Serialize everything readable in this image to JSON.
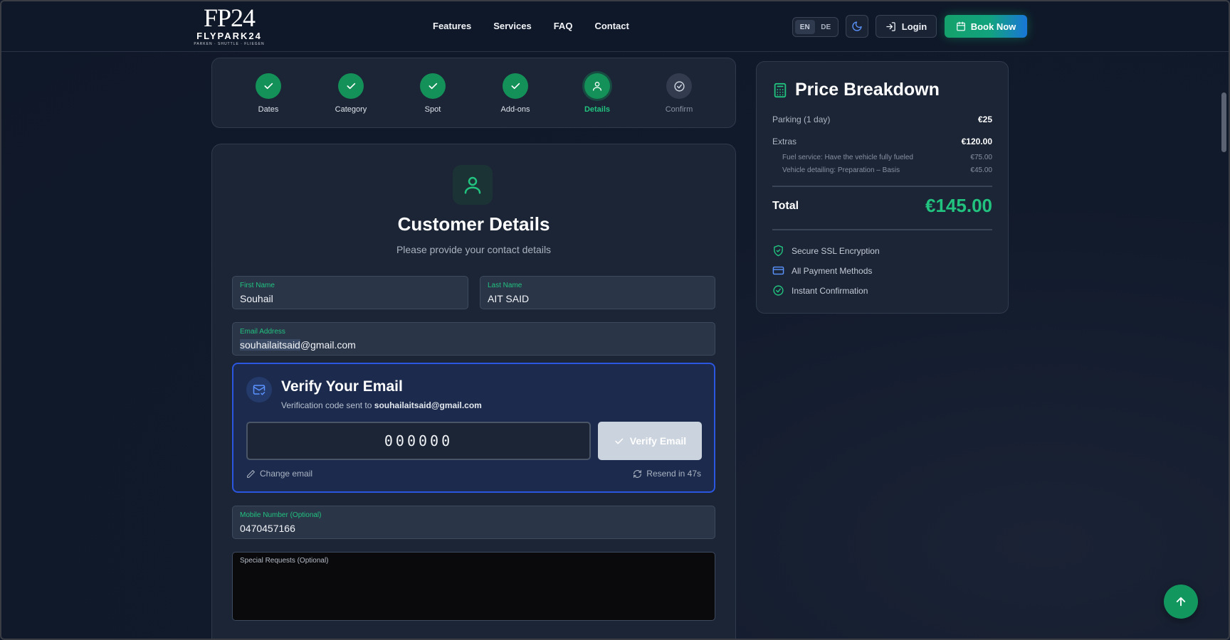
{
  "header": {
    "logo": {
      "mark": "FP24",
      "word": "FLYPARK24",
      "tagline": "PARKEN · SHUTTLE · FLIEGEN"
    },
    "nav": [
      "Features",
      "Services",
      "FAQ",
      "Contact"
    ],
    "lang": {
      "en": "EN",
      "de": "DE",
      "selected": "EN"
    },
    "login_label": "Login",
    "book_label": "Book Now"
  },
  "stepper": {
    "steps": [
      {
        "label": "Dates",
        "state": "done"
      },
      {
        "label": "Category",
        "state": "done"
      },
      {
        "label": "Spot",
        "state": "done"
      },
      {
        "label": "Add-ons",
        "state": "done"
      },
      {
        "label": "Details",
        "state": "current"
      },
      {
        "label": "Confirm",
        "state": "pending"
      }
    ]
  },
  "form": {
    "title": "Customer Details",
    "subtitle": "Please provide your contact details",
    "first_name": {
      "label": "First Name",
      "value": "Souhail"
    },
    "last_name": {
      "label": "Last Name",
      "value": "AIT SAID"
    },
    "email": {
      "label": "Email Address",
      "value_highlight": "souhailaitsaid",
      "value_rest": "@gmail.com"
    },
    "verify": {
      "title": "Verify Your Email",
      "sent_prefix": "Verification code sent to",
      "sent_to": "souhailaitsaid@gmail.com",
      "code_placeholder": "000000",
      "verify_label": "Verify Email",
      "change_label": "Change email",
      "resend_label": "Resend in 47s"
    },
    "mobile": {
      "label": "Mobile Number (Optional)",
      "value": "0470457166"
    },
    "special": {
      "label": "Special Requests (Optional)",
      "value": ""
    }
  },
  "price": {
    "title": "Price Breakdown",
    "parking_label": "Parking (1 day)",
    "parking_value": "€25",
    "extras_label": "Extras",
    "extras_value": "€120.00",
    "extras_items": [
      {
        "label": "Fuel service: Have the vehicle fully fueled",
        "value": "€75.00"
      },
      {
        "label": "Vehicle detailing: Preparation – Basis",
        "value": "€45.00"
      }
    ],
    "total_label": "Total",
    "total_value": "€145.00",
    "features": [
      "Secure SSL Encryption",
      "All Payment Methods",
      "Instant Confirmation"
    ]
  },
  "colors": {
    "accent_green": "#22c27f",
    "accent_blue": "#2a56e0",
    "background": "#111a2b"
  }
}
